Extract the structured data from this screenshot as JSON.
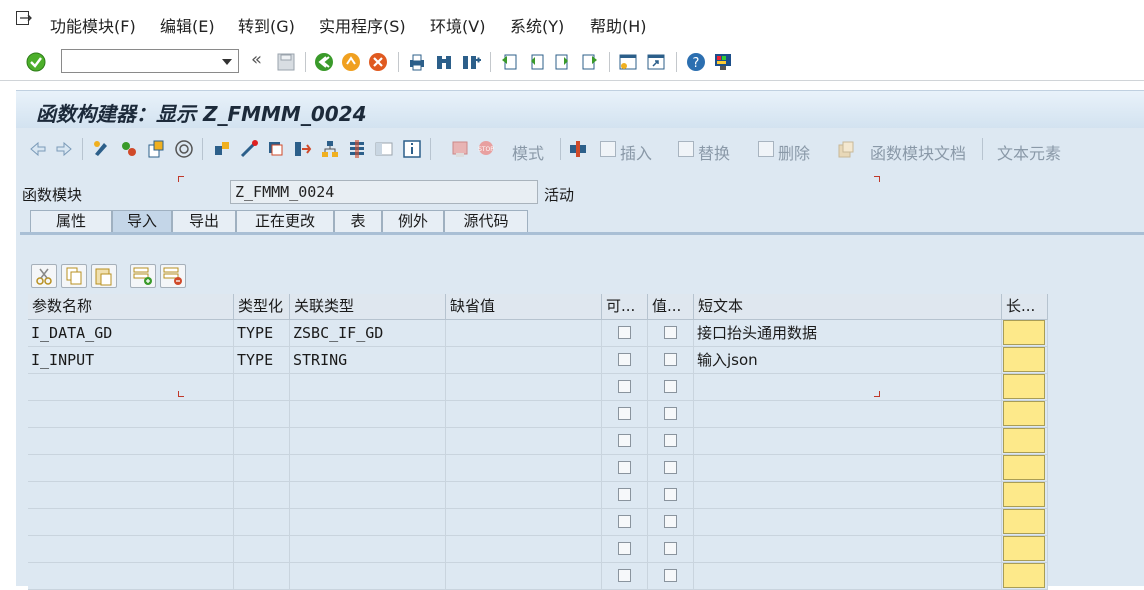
{
  "menu": {
    "items": [
      "功能模块(F)",
      "编辑(E)",
      "转到(G)",
      "实用程序(S)",
      "环境(V)",
      "系统(Y)",
      "帮助(H)"
    ]
  },
  "toolbar": {
    "command_value": "",
    "back_arrows": "«"
  },
  "title": "函数构建器：显示 Z_FMMM_0024",
  "app_toolbar": {
    "pattern_label": "模式",
    "insert_label": "插入",
    "replace_label": "替换",
    "delete_label": "删除",
    "doc_label": "函数模块文档",
    "text_elements_label": "文本元素"
  },
  "form": {
    "function_module_label": "函数模块",
    "function_module_value": "Z_FMMM_0024",
    "status": "活动"
  },
  "tabs": [
    "属性",
    "导入",
    "导出",
    "正在更改",
    "表",
    "例外",
    "源代码"
  ],
  "active_tab": "导入",
  "grid": {
    "headers": [
      "参数名称",
      "类型化",
      "关联类型",
      "缺省值",
      "可...",
      "值...",
      "短文本",
      "长..."
    ],
    "rows": [
      {
        "name": "I_DATA_GD",
        "typing": "TYPE",
        "ref_type": "ZSBC_IF_GD",
        "default": "",
        "short_text": "接口抬头通用数据"
      },
      {
        "name": "I_INPUT",
        "typing": "TYPE",
        "ref_type": "STRING",
        "default": "",
        "short_text": "输入json"
      },
      {
        "name": "",
        "typing": "",
        "ref_type": "",
        "default": "",
        "short_text": ""
      },
      {
        "name": "",
        "typing": "",
        "ref_type": "",
        "default": "",
        "short_text": ""
      },
      {
        "name": "",
        "typing": "",
        "ref_type": "",
        "default": "",
        "short_text": ""
      },
      {
        "name": "",
        "typing": "",
        "ref_type": "",
        "default": "",
        "short_text": ""
      },
      {
        "name": "",
        "typing": "",
        "ref_type": "",
        "default": "",
        "short_text": ""
      },
      {
        "name": "",
        "typing": "",
        "ref_type": "",
        "default": "",
        "short_text": ""
      },
      {
        "name": "",
        "typing": "",
        "ref_type": "",
        "default": "",
        "short_text": ""
      },
      {
        "name": "",
        "typing": "",
        "ref_type": "",
        "default": "",
        "short_text": ""
      }
    ]
  },
  "colors": {
    "title_bg": "#d2e2f0",
    "panel_bg": "#dde8f2",
    "long_text_button": "#fde98a",
    "disabled_label": "#8a99a8"
  }
}
